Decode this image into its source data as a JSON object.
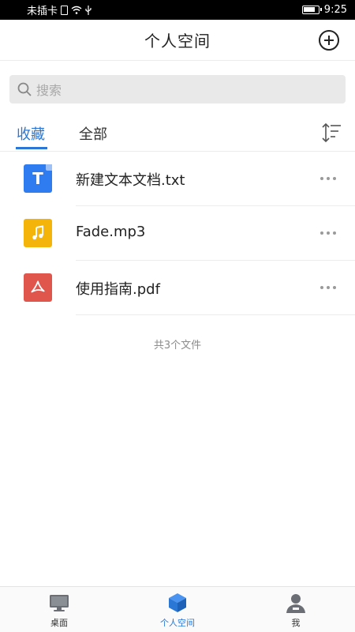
{
  "status_bar": {
    "carrier": "未插卡",
    "time": "9:25"
  },
  "header": {
    "title": "个人空间"
  },
  "search": {
    "placeholder": "搜索"
  },
  "tabs": [
    {
      "label": "收藏",
      "active": true
    },
    {
      "label": "全部",
      "active": false
    }
  ],
  "files": [
    {
      "name": "新建文本文档.txt",
      "icon": "text-file-icon",
      "color": "#2f7bf0"
    },
    {
      "name": "Fade.mp3",
      "icon": "music-file-icon",
      "color": "#f5b40a"
    },
    {
      "name": "使用指南.pdf",
      "icon": "pdf-file-icon",
      "color": "#e0564d"
    }
  ],
  "file_count": "共3个文件",
  "bottom_nav": [
    {
      "label": "桌面",
      "icon": "monitor-icon",
      "active": false
    },
    {
      "label": "个人空间",
      "icon": "cube-icon",
      "active": true
    },
    {
      "label": "我",
      "icon": "person-icon",
      "active": false
    }
  ],
  "colors": {
    "accent": "#2a77d6"
  }
}
